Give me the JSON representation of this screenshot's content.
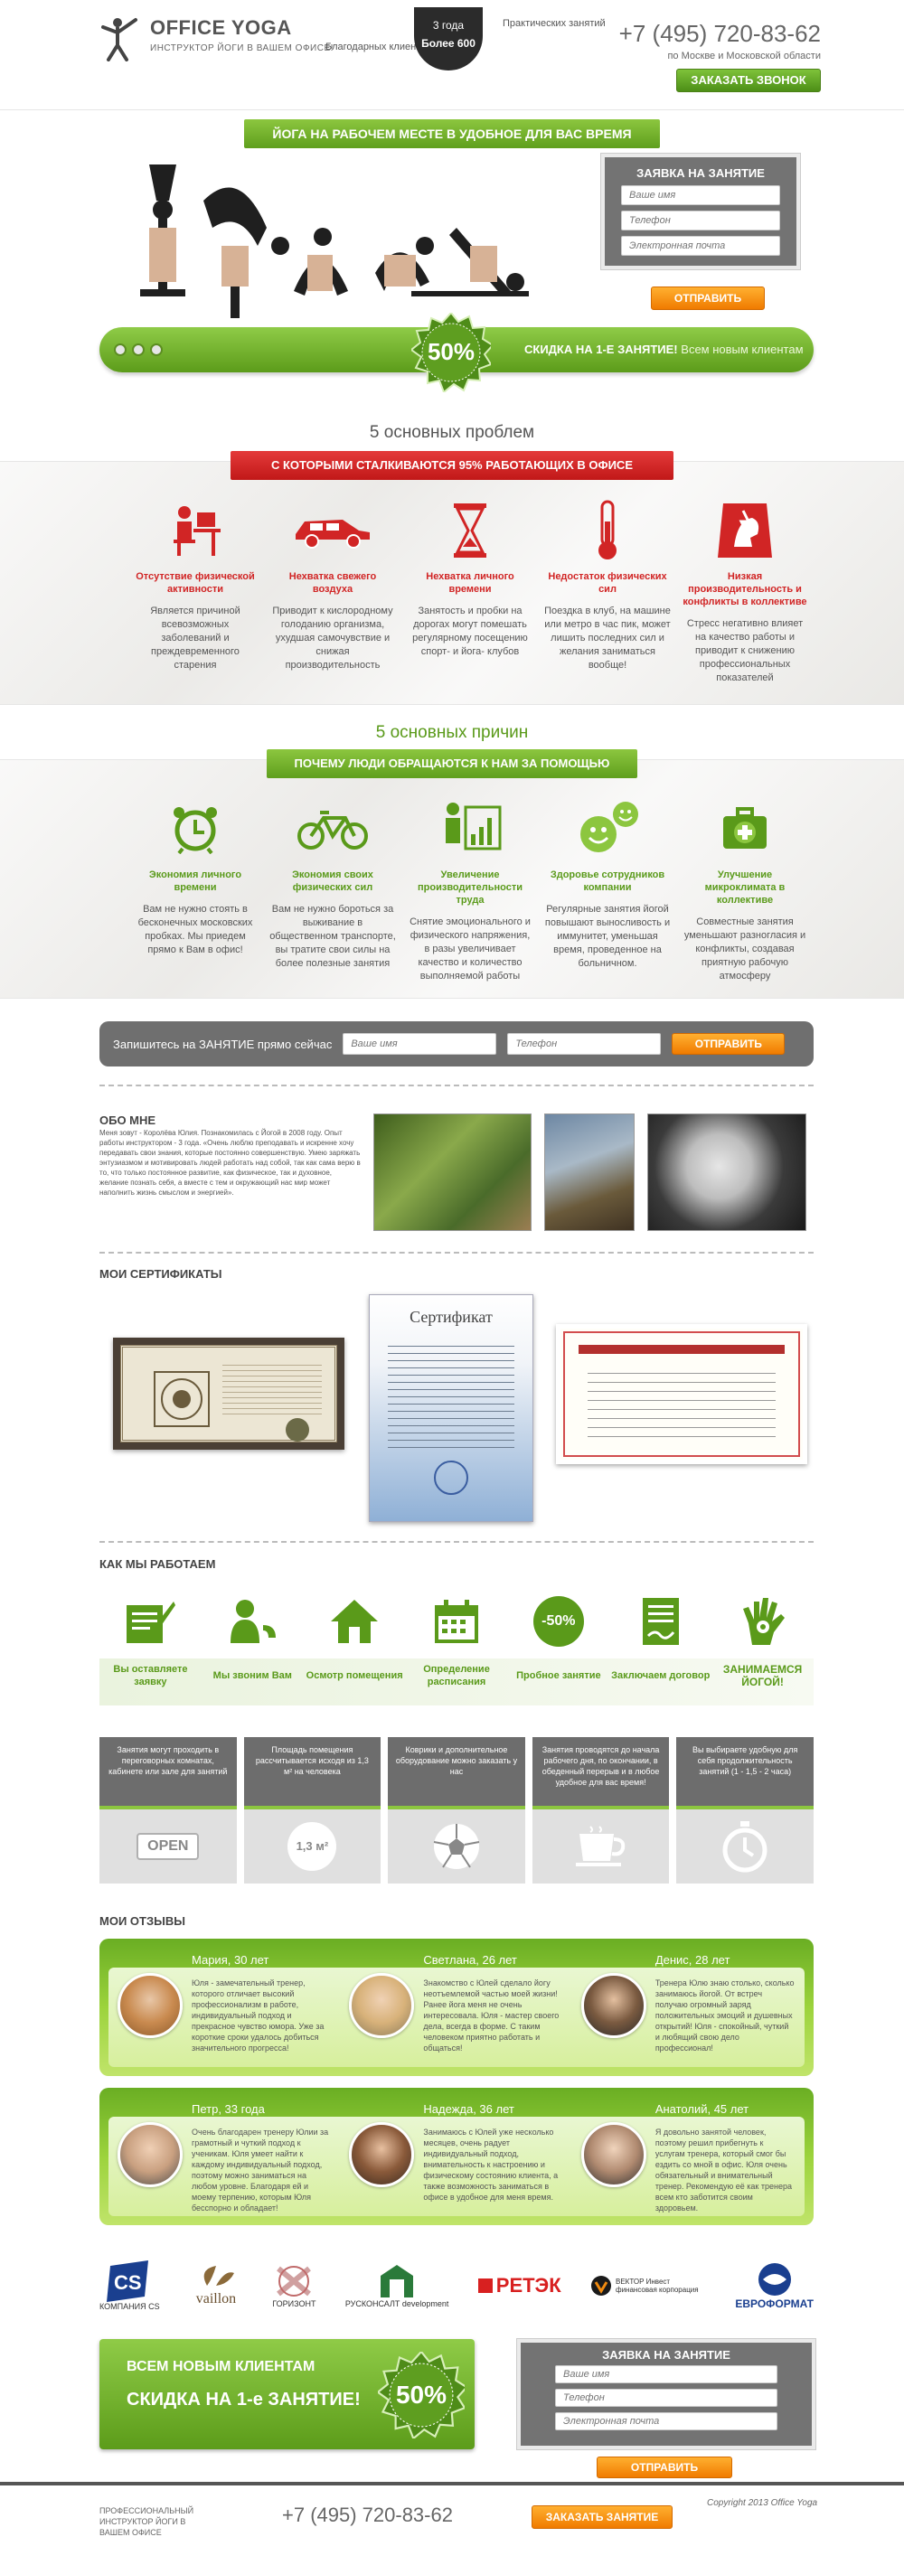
{
  "header": {
    "brand": "OFFICE YOGA",
    "tagline": "ИНСТРУКТОР ЙОГИ В ВАШЕМ ОФИСЕ!",
    "stat_left": "Благодарных клиентов",
    "stat_badge_top": "3 года",
    "stat_badge_bottom": "Более 600",
    "stat_right": "Практических занятий",
    "phone": "+7 (495) 720-83-62",
    "region": "по Москве и Московской области",
    "callback_button": "ЗАКАЗАТЬ ЗВОНОК"
  },
  "hero": {
    "title": "ЙОГА НА РАБОЧЕМ МЕСТЕ В УДОБНОЕ ДЛЯ ВАС ВРЕМЯ",
    "form_title": "ЗАЯВКА НА ЗАНЯТИЕ",
    "name_placeholder": "Ваше имя",
    "phone_placeholder": "Телефон",
    "email_placeholder": "Электронная почта",
    "send_button": "ОТПРАВИТЬ",
    "discount": "50%",
    "offer": "СКИДКА НА 1-е ЗАНЯТИЕ!",
    "offer_sub": "Всем новым клиентам"
  },
  "problems": {
    "heading": "5 основных проблем",
    "banner": "С КОТОРЫМИ СТАЛКИВАЮТСЯ 95% РАБОТАЮЩИХ В ОФИСЕ",
    "items": [
      {
        "title": "Отсутствие физической активности",
        "text": "Является причиной всевозможных заболеваний и преждевременного старения"
      },
      {
        "title": "Нехватка свежего воздуха",
        "text": "Приводит к кислородному голоданию организма, ухудшая самочувствие и снижая производительность"
      },
      {
        "title": "Нехватка личного времени",
        "text": "Занятость и пробки на дорогах могут помешать регулярному посещению спорт- и йога- клубов"
      },
      {
        "title": "Недостаток физических сил",
        "text": "Поездка в клуб, на машине или метро в час пик, может лишить последних сил и желания заниматься вообще!"
      },
      {
        "title": "Низкая производительность и конфликты в коллективе",
        "text": "Стресс негативно влияет на качество работы и приводит к снижению профессиональных показателей"
      }
    ]
  },
  "reasons": {
    "heading": "5 основных причин",
    "banner": "ПОЧЕМУ ЛЮДИ ОБРАЩАЮТСЯ К НАМ ЗА ПОМОЩЬЮ",
    "items": [
      {
        "title": "Экономия личного времени",
        "text": "Вам не нужно стоять в бесконечных московских пробках. Мы приедем прямо к Вам в офис!"
      },
      {
        "title": "Экономия своих физических сил",
        "text": "Вам не нужно бороться за выживание в общественном транспорте, вы тратите свои силы на более полезные занятия"
      },
      {
        "title": "Увеличение производительности труда",
        "text": "Снятие эмоционального и физического напряжения, в разы увеличивает качество и количество выполняемой работы"
      },
      {
        "title": "Здоровье сотрудников компании",
        "text": "Регулярные занятия йогой повышают выносливость и иммунитет, уменьшая время, проведенное на больничном."
      },
      {
        "title": "Улучшение микроклимата в коллективе",
        "text": "Совместные занятия уменьшают разногласия и конфликты, создавая приятную рабочую атмосферу"
      }
    ]
  },
  "strip": {
    "label": "Запишитесь на ЗАНЯТИЕ прямо сейчас",
    "name_placeholder": "Ваше имя",
    "phone_placeholder": "Телефон",
    "button": "ОТПРАВИТЬ"
  },
  "about": {
    "title": "ОБО МНЕ",
    "text": "Меня зовут - Королёва Юлия. Познакомилась с Йогой в 2008 году. Опыт работы инструктором - 3 года. «Очень люблю преподавать и искренне хочу передавать свои знания, которые постоянно совершенствую. Умею заряжать энтузиазмом и мотивировать людей работать над собой, так как сама верю в то, что только постоянное развитие, как физическое, так и духовное, желание познать себя, а вместе с тем и окружающий нас мир может наполнить жизнь смыслом и энергией»."
  },
  "certs": {
    "title": "МОИ СЕРТИФИКАТЫ",
    "cert2_label": "Сертификат"
  },
  "how": {
    "title": "КАК МЫ РАБОТАЕМ",
    "steps": [
      {
        "label": "Вы оставляете заявку",
        "icon": "form-icon"
      },
      {
        "label": "Мы звоним Вам",
        "icon": "phone-call-icon"
      },
      {
        "label": "Осмотр помещения",
        "icon": "house-icon"
      },
      {
        "label": "Определение расписания",
        "icon": "calendar-icon"
      },
      {
        "label": "Пробное занятие",
        "icon": "discount-icon",
        "badge": "-50%"
      },
      {
        "label": "Заключаем договор",
        "icon": "contract-icon"
      },
      {
        "label": "ЗАНИМАЕМСЯ ЙОГОЙ!",
        "icon": "yoga-hand-icon"
      }
    ],
    "info": [
      {
        "text": "Занятия могут проходить в переговорных комнатах, кабинете или зале для занятий",
        "icon": "open-sign-icon",
        "icon_text": "OPEN"
      },
      {
        "text": "Площадь помещения рассчитывается исходя из 1,3 м² на человека",
        "icon": "area-icon",
        "icon_text": "1,3 м²"
      },
      {
        "text": "Коврики и дополнительное оборудование можно заказать у нас",
        "icon": "ball-icon",
        "icon_text": ""
      },
      {
        "text": "Занятия проводятся до начала рабочего дня, по окончании, в обеденный перерыв и в любое удобное для вас время!",
        "icon": "cup-icon",
        "icon_text": ""
      },
      {
        "text": "Вы выбираете удобную для себя продолжительность занятий (1 - 1,5 - 2 часа)",
        "icon": "stopwatch-icon",
        "icon_text": ""
      }
    ]
  },
  "reviews": {
    "title": "МОИ ОТЗЫВЫ",
    "row1": [
      {
        "name": "Мария, 30 лет",
        "text": "Юля - замечательный тренер, которого отличает высокий профессионализм в работе, индивидуальный подход и прекрасное чувство юмора. Уже за короткие сроки удалось добиться значительного прогресса!"
      },
      {
        "name": "Светлана, 26 лет",
        "text": "Знакомство с Юлей сделало йогу неотъемлемой частью моей жизни! Ранее йога меня не очень интересовала. Юля - мастер своего дела, всегда в форме. С таким человеком приятно работать и общаться!"
      },
      {
        "name": "Денис, 28 лет",
        "text": "Тренера Юлю знаю столько, сколько занимаюсь йогой. От встреч получаю огромный заряд положительных эмоций и душевных открытий! Юля - спокойный, чуткий и любящий свою дело профессионал!"
      }
    ],
    "row2": [
      {
        "name": "Петр, 33 года",
        "text": "Очень благодарен тренеру Юлии за грамотный и чуткий подход к ученикам. Юля умеет найти к каждому индивидуальный подход, поэтому можно заниматься на любом уровне. Благодаря ей и моему терпению, которым Юля бесспорно и обладает!"
      },
      {
        "name": "Надежда, 36 лет",
        "text": "Занимаюсь с Юлей уже несколько месяцев, очень радует индивидуальный подход, внимательность к настроению и физическому состоянию клиента, а также возможность заниматься в офисе в удобное для меня время."
      },
      {
        "name": "Анатолий, 45 лет",
        "text": "Я довольно занятой человек, поэтому решил прибегнуть к услугам тренера, который смог бы ездить со мной в офис. Юля очень обязательный и внимательный тренер. Рекомендую её как тренера всем кто заботится своим здоровьем."
      }
    ]
  },
  "clients": [
    {
      "name": "КОМПАНИЯ CS",
      "icon": "cs-logo"
    },
    {
      "name": "vaillon",
      "icon": "vaillon-logo"
    },
    {
      "name": "ГОРИЗОНТ",
      "icon": "gorizont-logo"
    },
    {
      "name": "РУСКОНСАЛТ development",
      "icon": "rusconsult-logo"
    },
    {
      "name": "РЕТЭК",
      "icon": "retek-logo"
    },
    {
      "name": "ВЕКТОР Инвест финансовая корпорация",
      "icon": "vektor-logo"
    },
    {
      "name": "ЕВРОФОРМАТ",
      "icon": "evroformat-logo"
    }
  ],
  "bottom": {
    "promo_line1": "ВСЕМ НОВЫМ КЛИЕНТАМ",
    "promo_line2": "СКИДКА НА 1-е ЗАНЯТИЕ!",
    "discount": "50%",
    "form_title": "ЗАЯВКА НА ЗАНЯТИЕ",
    "name_placeholder": "Ваше имя",
    "phone_placeholder": "Телефон",
    "email_placeholder": "Электронная почта",
    "send_button": "ОТПРАВИТЬ"
  },
  "footer": {
    "tagline": "ПРОФЕССИОНАЛЬНЫЙ ИНСТРУКТОР ЙОГИ В ВАШЕМ ОФИСЕ",
    "phone": "+7 (495) 720-83-62",
    "button": "ЗАКАЗАТЬ ЗАНЯТИЕ",
    "copyright": "Copyright 2013 Office Yoga"
  }
}
